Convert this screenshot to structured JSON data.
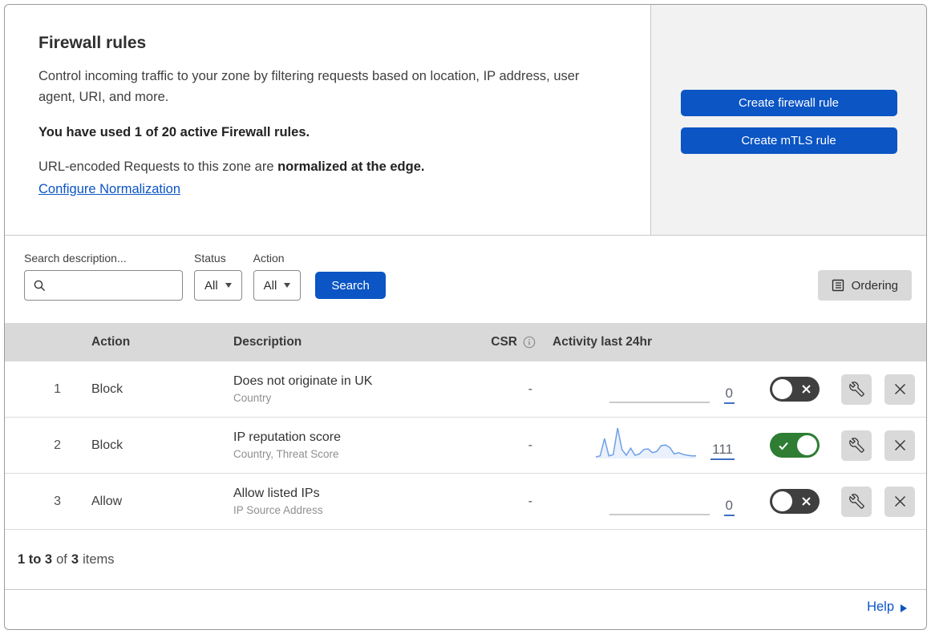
{
  "header": {
    "title": "Firewall rules",
    "description": "Control incoming traffic to your zone by filtering requests based on location, IP address, user agent, URI, and more.",
    "usage": "You have used 1 of 20 active Firewall rules.",
    "normalization_text": "URL-encoded Requests to this zone are ",
    "normalization_bold": "normalized at the edge.",
    "normalization_link": "Configure Normalization",
    "create_firewall_button": "Create firewall rule",
    "create_mtls_button": "Create mTLS rule"
  },
  "filters": {
    "search_label": "Search description...",
    "search_value": "",
    "status_label": "Status",
    "status_value": "All",
    "action_label": "Action",
    "action_value": "All",
    "search_button": "Search",
    "ordering_button": "Ordering"
  },
  "table": {
    "headers": {
      "action": "Action",
      "description": "Description",
      "csr": "CSR",
      "activity": "Activity last 24hr"
    },
    "rows": [
      {
        "number": "1",
        "action": "Block",
        "description": "Does not originate in UK",
        "criteria": "Country",
        "csr": "-",
        "activity_count": "0",
        "enabled": false,
        "sparkline": [
          0,
          0,
          0,
          0,
          0,
          0,
          0,
          0,
          0,
          0,
          0,
          0,
          0,
          0,
          0,
          0,
          0,
          0,
          0,
          0,
          0,
          0,
          0,
          0
        ]
      },
      {
        "number": "2",
        "action": "Block",
        "description": "IP reputation score",
        "criteria": "Country, Threat Score",
        "csr": "-",
        "activity_count": "111",
        "enabled": true,
        "sparkline": [
          5,
          8,
          62,
          8,
          12,
          95,
          28,
          10,
          32,
          10,
          14,
          28,
          30,
          18,
          22,
          40,
          42,
          34,
          14,
          18,
          13,
          10,
          8,
          8
        ]
      },
      {
        "number": "3",
        "action": "Allow",
        "description": "Allow listed IPs",
        "criteria": "IP Source Address",
        "csr": "-",
        "activity_count": "0",
        "enabled": false,
        "sparkline": [
          0,
          0,
          0,
          0,
          0,
          0,
          0,
          0,
          0,
          0,
          0,
          0,
          0,
          0,
          0,
          0,
          0,
          0,
          0,
          0,
          0,
          0,
          0,
          0
        ]
      }
    ]
  },
  "footer": {
    "range": "1 to 3",
    "of_label": "of",
    "total": "3",
    "items_label": "items",
    "help_label": "Help"
  },
  "icons": {
    "search": "magnifier",
    "dropdown": "caret-down",
    "ordering": "document-lines",
    "csr_info": "circled-i",
    "row_edit": "wrench",
    "row_delete": "x",
    "toggle_on": "checkmark",
    "toggle_off": "x",
    "help": "right-triangle"
  },
  "colors": {
    "primary_blue": "#0b55c4",
    "panel_bg": "#f2f2f2",
    "thead_bg": "#d9d9d9",
    "button_gray": "#d9d9d9",
    "toggle_on_green": "#2e7d33",
    "toggle_off_gray": "#3f3f3f",
    "sparkline_stroke": "#6d9fe8",
    "sparkline_fill": "rgba(109,159,232,0.14)",
    "sparkline_flat": "#b9b9b9"
  }
}
